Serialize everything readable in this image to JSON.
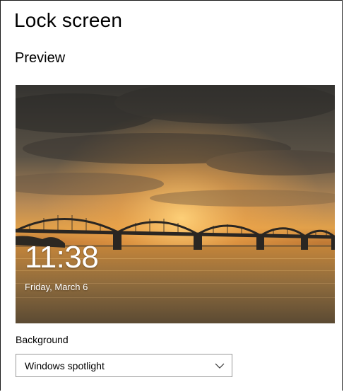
{
  "page": {
    "title": "Lock screen",
    "section_title": "Preview"
  },
  "preview": {
    "time": "11:38",
    "date": "Friday, March 6"
  },
  "background": {
    "label": "Background",
    "selected": "Windows spotlight",
    "dropdown_icon": "chevron-down-icon"
  },
  "colors": {
    "text": "#000000",
    "dropdown_border": "#999999",
    "sky_top": "#3b3a38",
    "sunset_glow": "#e39a3a",
    "water": "#8a6a3a"
  }
}
